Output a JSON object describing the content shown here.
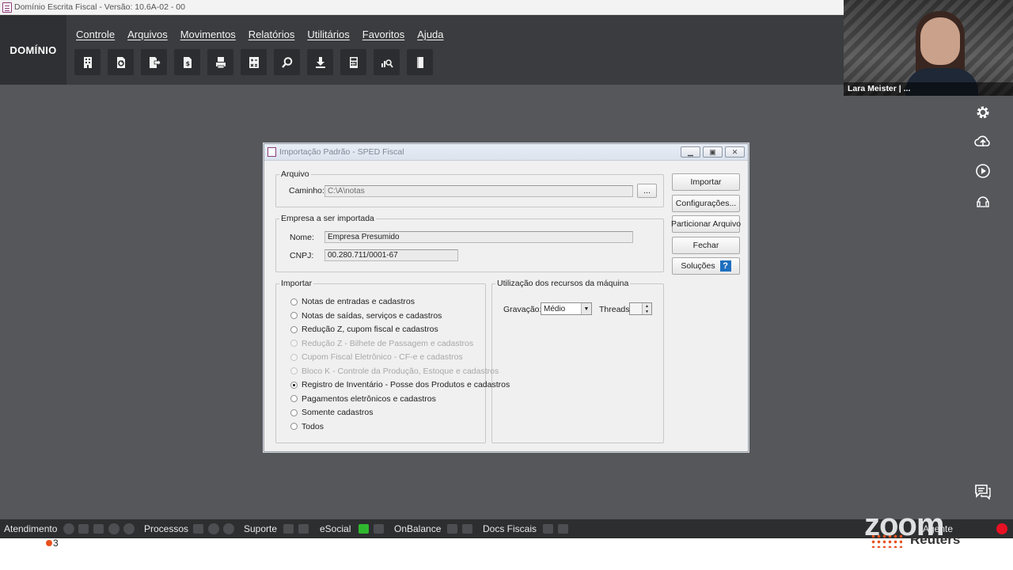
{
  "app": {
    "title": "Domínio Escrita Fiscal  - Versão: 10.6A-02 - 00",
    "brand": "DOMÍNIO"
  },
  "menu": {
    "items": [
      "Controle",
      "Arquivos",
      "Movimentos",
      "Relatórios",
      "Utilitários",
      "Favoritos",
      "Ajuda"
    ]
  },
  "toolbar": {
    "icons": [
      "building-icon",
      "refresh-doc-icon",
      "export-doc-icon",
      "invoice-icon",
      "printer-icon",
      "calculator-sheet-icon",
      "search-icon",
      "download-icon",
      "calculator-icon",
      "chart-search-icon",
      "book-icon"
    ]
  },
  "dialog": {
    "title": "Importação Padrão - SPED Fiscal",
    "arquivo": {
      "legend": "Arquivo",
      "caminho_label": "Caminho:",
      "caminho_value": "C:\\A\\notas",
      "browse_label": "..."
    },
    "empresa": {
      "legend": "Empresa a ser importada",
      "nome_label": "Nome:",
      "nome_value": "Empresa Presumido",
      "cnpj_label": "CNPJ:",
      "cnpj_value": "00.280.711/0001-67"
    },
    "importar": {
      "legend": "Importar",
      "options": [
        {
          "label": "Notas de entradas e cadastros",
          "enabled": true,
          "checked": false
        },
        {
          "label": "Notas de saídas, serviços e cadastros",
          "enabled": true,
          "checked": false
        },
        {
          "label": "Redução Z, cupom fiscal e cadastros",
          "enabled": true,
          "checked": false
        },
        {
          "label": "Redução Z - Bilhete de Passagem e cadastros",
          "enabled": false,
          "checked": false
        },
        {
          "label": "Cupom Fiscal Eletrônico - CF-e e cadastros",
          "enabled": false,
          "checked": false
        },
        {
          "label": "Bloco K - Controle da Produção, Estoque e cadastros",
          "enabled": false,
          "checked": false
        },
        {
          "label": "Registro de Inventário - Posse dos Produtos e cadastros",
          "enabled": true,
          "checked": true
        },
        {
          "label": "Pagamentos eletrônicos e cadastros",
          "enabled": true,
          "checked": false
        },
        {
          "label": "Somente cadastros",
          "enabled": true,
          "checked": false
        },
        {
          "label": "Todos",
          "enabled": true,
          "checked": false
        }
      ]
    },
    "recursos": {
      "legend": "Utilização dos recursos da máquina",
      "gravacao_label": "Gravação:",
      "gravacao_value": "Médio",
      "threads_label": "Threads:",
      "threads_value": ""
    },
    "buttons": {
      "importar": "Importar",
      "configuracoes": "Configurações...",
      "particionar": "Particionar Arquivo",
      "fechar": "Fechar",
      "solucoes": "Soluções",
      "solucoes_help": "?"
    }
  },
  "video": {
    "participant_name": "Lara Meister | ..."
  },
  "statusbar": {
    "atendimento": "Atendimento",
    "processos": "Processos",
    "suporte": "Suporte",
    "esocial": "eSocial",
    "onbalance": "OnBalance",
    "docs_fiscais": "Docs Fiscais",
    "agente": "Agente",
    "badge_count": "3"
  },
  "overlay": {
    "zoom_logo": "zoom",
    "reuters": "Reuters"
  },
  "colors": {
    "app_background": "#55575b",
    "menu_band": "#3b3c3f",
    "status_bar": "#2d2e30",
    "help_blue": "#1d6fbf",
    "esocial_green": "#2fb82f",
    "record_red": "#e81123"
  }
}
